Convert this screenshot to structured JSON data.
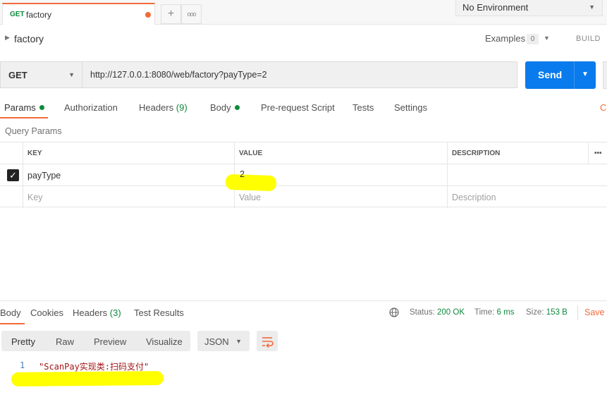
{
  "tab": {
    "method": "GET",
    "name": "factory"
  },
  "tab_buttons": {
    "new": "+",
    "more": "ooo"
  },
  "environment": {
    "selected": "No Environment"
  },
  "request": {
    "title": "factory",
    "examples_label": "Examples",
    "examples_count": "0",
    "build_label": "BUILD",
    "method": "GET",
    "url": "http://127.0.0.1:8080/web/factory?payType=2",
    "send_label": "Send"
  },
  "request_tabs": {
    "params": "Params",
    "authorization": "Authorization",
    "headers": "Headers",
    "headers_count": "(9)",
    "body": "Body",
    "prerequest": "Pre-request Script",
    "tests": "Tests",
    "settings": "Settings",
    "cookies_stub": "C"
  },
  "query_params": {
    "title": "Query Params",
    "columns": {
      "key": "KEY",
      "value": "VALUE",
      "description": "DESCRIPTION",
      "more": "•••"
    },
    "rows": [
      {
        "checked": true,
        "key": "payType",
        "value": "2",
        "description": ""
      }
    ],
    "placeholders": {
      "key": "Key",
      "value": "Value",
      "description": "Description"
    }
  },
  "response": {
    "tabs": {
      "body": "Body",
      "cookies": "Cookies",
      "headers": "Headers",
      "headers_count": "(3)",
      "test_results": "Test Results"
    },
    "status_label": "Status:",
    "status_value": "200 OK",
    "time_label": "Time:",
    "time_value": "6 ms",
    "size_label": "Size:",
    "size_value": "153 B",
    "save_label": "Save I",
    "view_modes": {
      "pretty": "Pretty",
      "raw": "Raw",
      "preview": "Preview",
      "visualize": "Visualize"
    },
    "format": "JSON",
    "line_number": "1",
    "body_text": "\"ScanPay实现类:扫码支付\""
  },
  "colors": {
    "accent": "#f26b3a",
    "send": "#097bed",
    "success": "#0d8a3c",
    "highlight": "#ffff00"
  }
}
